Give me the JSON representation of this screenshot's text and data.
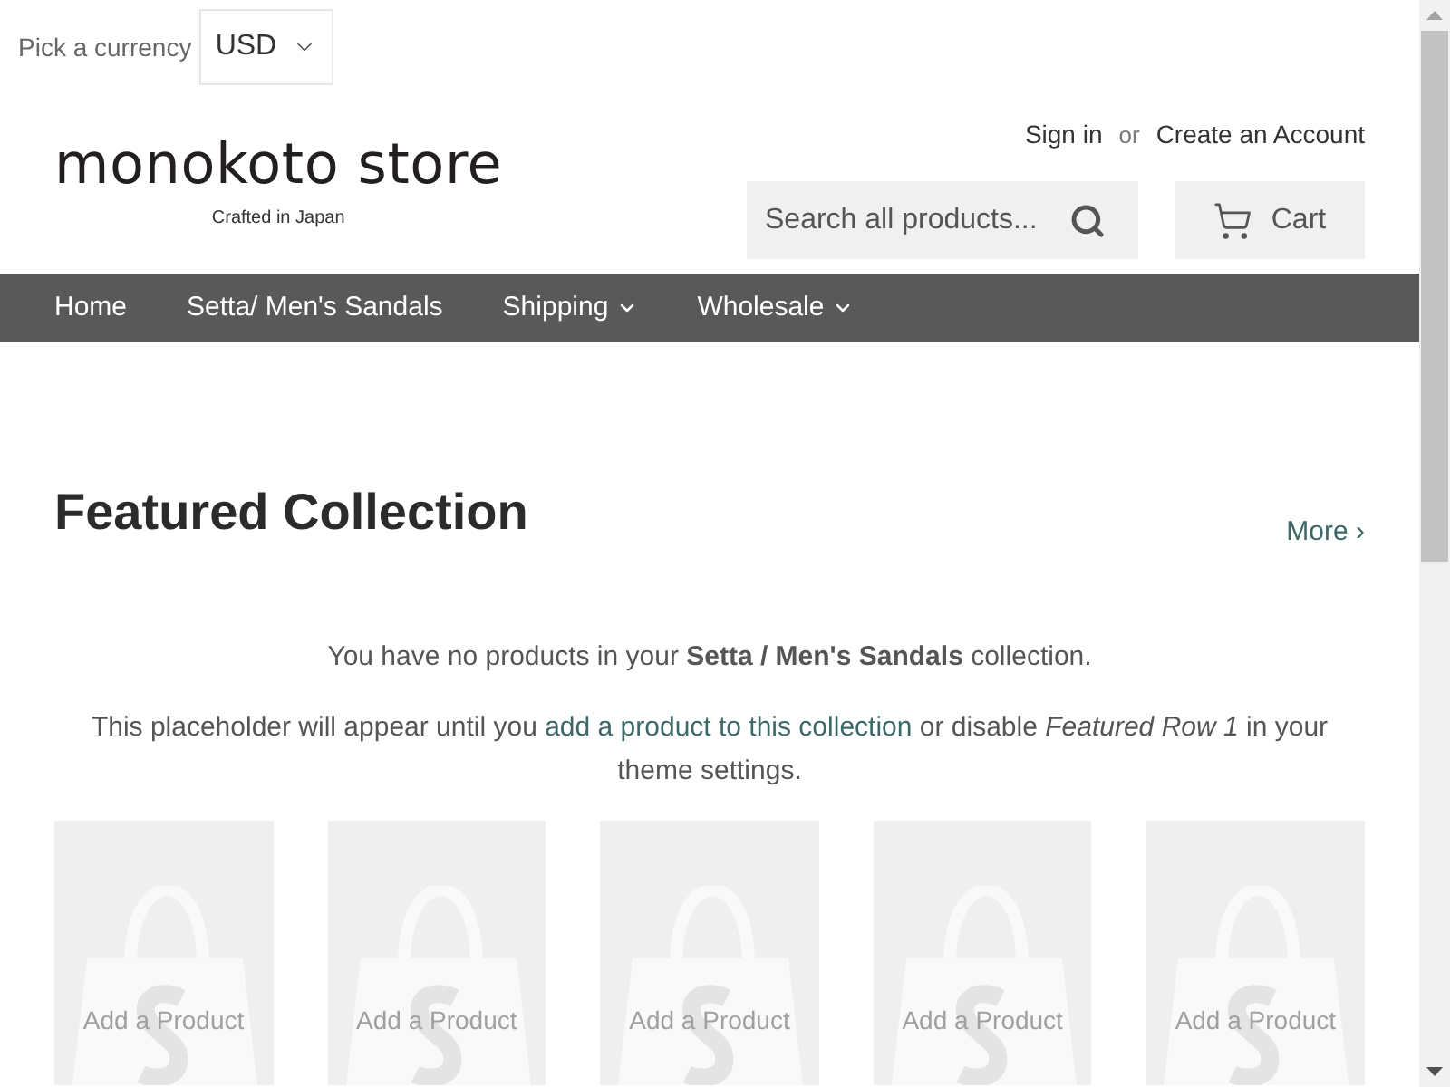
{
  "currency_picker": {
    "label": "Pick a currency",
    "value": "USD"
  },
  "header": {
    "logo": {
      "name": "monokoto store",
      "tagline": "Crafted in Japan"
    },
    "account_links": {
      "sign_in": "Sign in",
      "separator": "or",
      "create_account": "Create an Account"
    },
    "search": {
      "placeholder": "Search all products..."
    },
    "cart": {
      "label": "Cart"
    }
  },
  "nav": {
    "items": [
      {
        "label": "Home",
        "kind": "link"
      },
      {
        "label": "Setta/ Men's Sandals",
        "kind": "link"
      },
      {
        "label": "Shipping",
        "kind": "dropdown"
      },
      {
        "label": "Wholesale",
        "kind": "dropdown"
      }
    ]
  },
  "featured": {
    "title": "Featured Collection",
    "more_link": "More ›",
    "message": "You have no products in your **Setta / Men's Sandals** collection.",
    "notice": {
      "before": "This placeholder will appear until you",
      "link": "add a product to this collection",
      "after": "or disable *Featured Row 1* in your theme settings."
    },
    "placeholders": [
      {
        "label": "Add a Product"
      },
      {
        "label": "Add a Product"
      },
      {
        "label": "Add a Product"
      },
      {
        "label": "Add a Product"
      },
      {
        "label": "Add a Product"
      }
    ]
  }
}
